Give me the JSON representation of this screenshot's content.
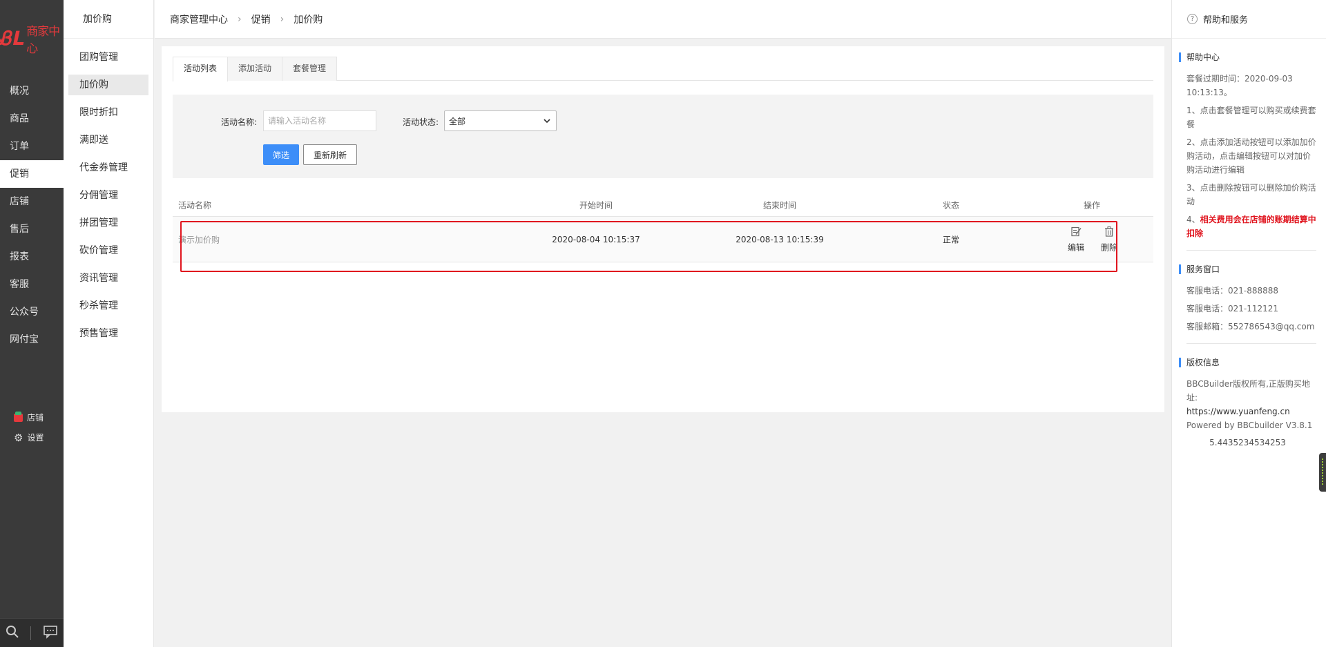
{
  "logo": {
    "text": "商家中心",
    "color": "#e4393c"
  },
  "rail": {
    "items": [
      {
        "label": "概况"
      },
      {
        "label": "商品"
      },
      {
        "label": "订单"
      },
      {
        "label": "促销",
        "active": true
      },
      {
        "label": "店铺"
      },
      {
        "label": "售后"
      },
      {
        "label": "报表"
      },
      {
        "label": "客服"
      },
      {
        "label": "公众号"
      },
      {
        "label": "网付宝"
      }
    ],
    "store_link": "店铺",
    "settings_link": "设置"
  },
  "subnav": {
    "title": "加价购",
    "items": [
      {
        "label": "团购管理"
      },
      {
        "label": "加价购",
        "active": true
      },
      {
        "label": "限时折扣"
      },
      {
        "label": "满即送"
      },
      {
        "label": "代金券管理"
      },
      {
        "label": "分佣管理"
      },
      {
        "label": "拼团管理"
      },
      {
        "label": "砍价管理"
      },
      {
        "label": "资讯管理"
      },
      {
        "label": "秒杀管理"
      },
      {
        "label": "预售管理"
      }
    ]
  },
  "breadcrumb": [
    "商家管理中心",
    "促销",
    "加价购"
  ],
  "tabs": [
    {
      "label": "活动列表",
      "active": true
    },
    {
      "label": "添加活动"
    },
    {
      "label": "套餐管理"
    }
  ],
  "filter": {
    "name_label": "活动名称:",
    "name_placeholder": "请输入活动名称",
    "name_value": "",
    "status_label": "活动状态:",
    "status_value": "全部",
    "filter_button": "筛选",
    "refresh_button": "重新刷新"
  },
  "table": {
    "columns": [
      "活动名称",
      "开始时间",
      "结束时间",
      "状态",
      "操作"
    ],
    "rows": [
      {
        "name": "演示加价购",
        "start": "2020-08-04 10:15:37",
        "end": "2020-08-13 10:15:39",
        "status": "正常",
        "edit": "编辑",
        "delete": "删除"
      }
    ]
  },
  "help": {
    "header": "帮助和服务",
    "help_center_title": "帮助中心",
    "help_items": [
      "套餐过期时间：2020-09-03 10:13:13。",
      "1、点击套餐管理可以购买或续费套餐",
      "2、点击添加活动按钮可以添加加价购活动，点击编辑按钮可以对加价购活动进行编辑",
      "3、点击删除按钮可以删除加价购活动"
    ],
    "help_item_4_prefix": "4、",
    "help_item_4_red": "相关费用会在店铺的账期结算中扣除",
    "service_title": "服务窗口",
    "service_items": [
      "客服电话：021-888888",
      "客服电话：021-112121",
      "客服邮箱：552786543@qq.com"
    ],
    "copyright_title": "版权信息",
    "copyright_lines": [
      "BBCBuilder版权所有,正版购买地址:",
      "https://www.yuanfeng.cn",
      "Powered by BBCbuilder V3.8.1"
    ],
    "version": "5.4435234534253"
  },
  "colors": {
    "accent": "#3d8ef8",
    "highlight": "#e0141e",
    "rail_bg": "#3a3a3a"
  }
}
